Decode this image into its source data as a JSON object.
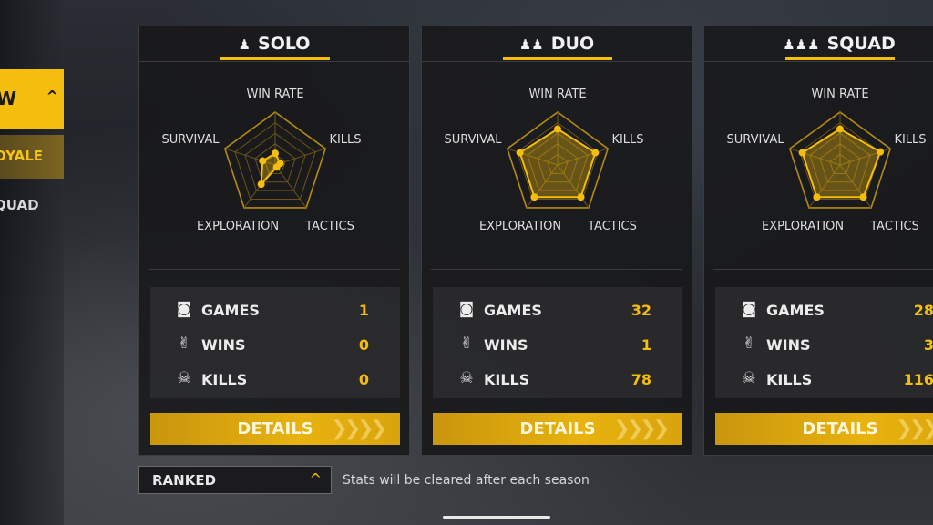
{
  "sidebar": {
    "header_label": "W",
    "header_chevron": "^",
    "items": [
      {
        "label": "OYALE"
      },
      {
        "label": "QUAD"
      }
    ]
  },
  "modes": [
    {
      "title": "SOLO",
      "icon": "solo-icon",
      "radar": {
        "axes": [
          "WIN RATE",
          "KILLS",
          "TACTICS",
          "EXPLORATION",
          "SURVIVAL"
        ],
        "values": [
          0.22,
          0.1,
          0.05,
          0.45,
          0.25
        ]
      },
      "stats": [
        {
          "label": "GAMES",
          "value": "1",
          "icon": "gamepad-icon"
        },
        {
          "label": "WINS",
          "value": "0",
          "icon": "victory-hand-icon"
        },
        {
          "label": "KILLS",
          "value": "0",
          "icon": "skull-icon"
        }
      ],
      "details_label": "DETAILS"
    },
    {
      "title": "DUO",
      "icon": "duo-icon",
      "radar": {
        "axes": [
          "WIN RATE",
          "KILLS",
          "TACTICS",
          "EXPLORATION",
          "SURVIVAL"
        ],
        "values": [
          0.68,
          0.75,
          0.75,
          0.75,
          0.75
        ]
      },
      "stats": [
        {
          "label": "GAMES",
          "value": "32",
          "icon": "gamepad-icon"
        },
        {
          "label": "WINS",
          "value": "1",
          "icon": "victory-hand-icon"
        },
        {
          "label": "KILLS",
          "value": "78",
          "icon": "skull-icon"
        }
      ],
      "details_label": "DETAILS"
    },
    {
      "title": "SQUAD",
      "icon": "squad-icon",
      "radar": {
        "axes": [
          "WIN RATE",
          "KILLS",
          "TACTICS",
          "EXPLORATION",
          "SURVIVAL"
        ],
        "values": [
          0.68,
          0.8,
          0.75,
          0.75,
          0.75
        ]
      },
      "stats": [
        {
          "label": "GAMES",
          "value": "28",
          "icon": "gamepad-icon"
        },
        {
          "label": "WINS",
          "value": "3",
          "icon": "victory-hand-icon"
        },
        {
          "label": "KILLS",
          "value": "116",
          "icon": "skull-icon"
        }
      ],
      "details_label": "DETAILS"
    }
  ],
  "season": {
    "selector_label": "RANKED",
    "chevron": "^",
    "note": "Stats will be cleared after each season"
  },
  "colors": {
    "accent": "#f5bd0c",
    "panel": "#18181a"
  }
}
